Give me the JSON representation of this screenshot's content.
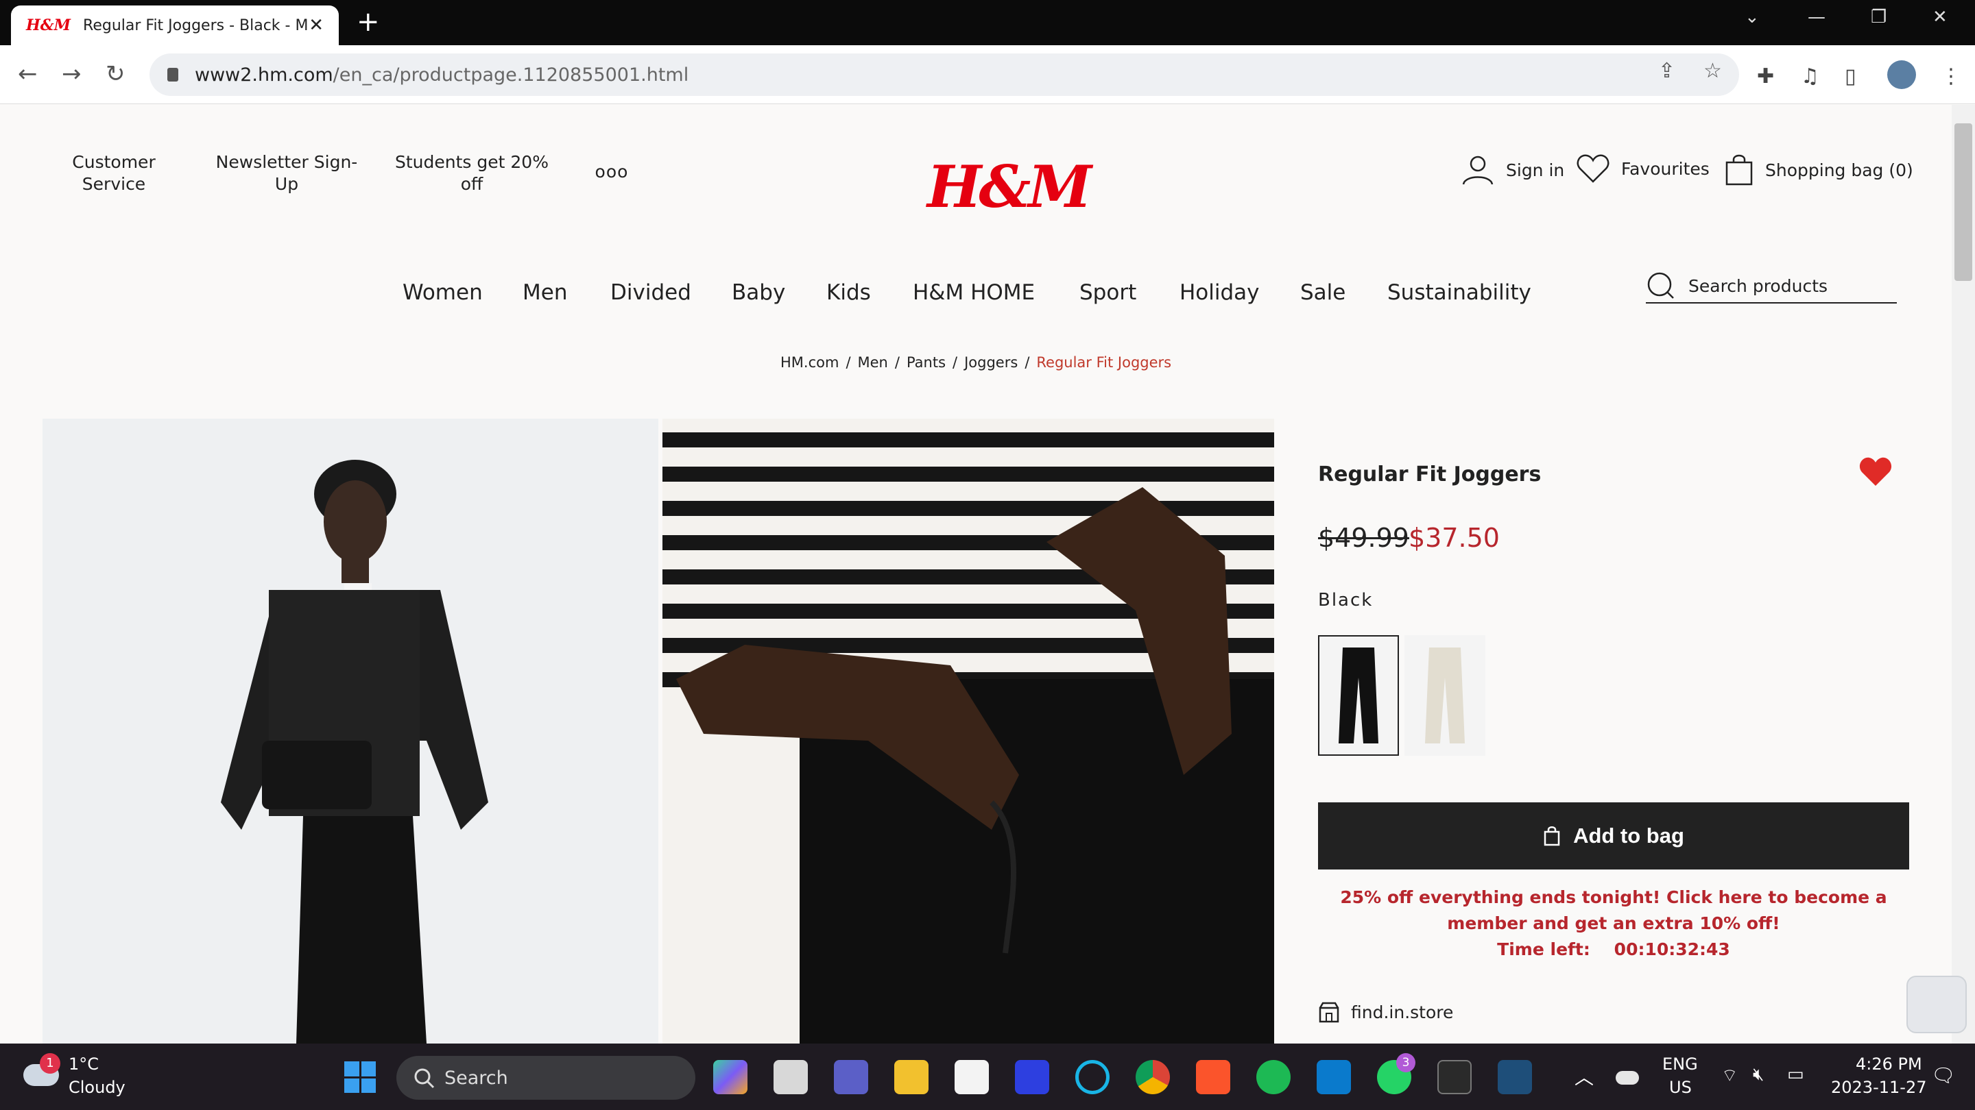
{
  "browser": {
    "tab_title": "Regular Fit Joggers - Black - Men",
    "tab_favicon": "H&M",
    "url_host": "www2.hm.com",
    "url_path": "/en_ca/productpage.1120855001.html"
  },
  "header": {
    "links": [
      "Customer Service",
      "Newsletter Sign-Up",
      "Students get 20% off"
    ],
    "more_label": "ooo",
    "logo": "H&M",
    "sign_in": "Sign in",
    "favourites": "Favourites",
    "shopping_bag": "Shopping bag (0)"
  },
  "main_nav": [
    "Women",
    "Men",
    "Divided",
    "Baby",
    "Kids",
    "H&M HOME",
    "Sport",
    "Holiday",
    "Sale",
    "Sustainability"
  ],
  "search": {
    "placeholder": "Search products"
  },
  "breadcrumb": [
    "HM.com",
    "Men",
    "Pants",
    "Joggers",
    "Regular Fit Joggers"
  ],
  "product": {
    "title": "Regular Fit Joggers",
    "old_price": "$49.99",
    "new_price": "$37.50",
    "color": "Black",
    "swatches": [
      "black",
      "beige"
    ],
    "add_to_bag": "Add to bag",
    "promo_line1": "25% off everything ends tonight! Click here to become a member and get an extra 10% off!",
    "promo_line2": "Time left:    00:10:32:43",
    "find_in_store": "find.in.store"
  },
  "taskbar": {
    "weather_temp": "1°C",
    "weather_desc": "Cloudy",
    "weather_badge": "1",
    "search": "Search",
    "whatsapp_badge": "3",
    "lang1": "ENG",
    "lang2": "US",
    "time": "4:26 PM",
    "date": "2023-11-27"
  },
  "colors": {
    "brand_red": "#e50010",
    "sale_red": "#b7262d",
    "button_dark": "#222222"
  }
}
